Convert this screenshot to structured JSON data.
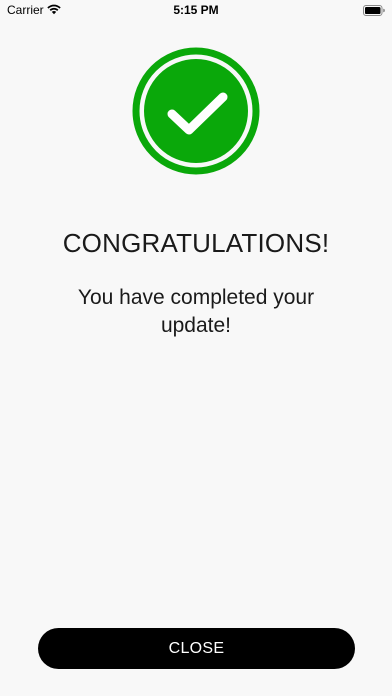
{
  "status_bar": {
    "carrier": "Carrier",
    "time": "5:15 PM",
    "icons": [
      "wifi-icon",
      "battery-icon"
    ]
  },
  "success": {
    "icon": "checkmark-circle-icon",
    "color": "#0aa80a",
    "title": "CONGRATULATIONS!",
    "message": "You have completed your update!"
  },
  "actions": {
    "close_label": "CLOSE"
  }
}
